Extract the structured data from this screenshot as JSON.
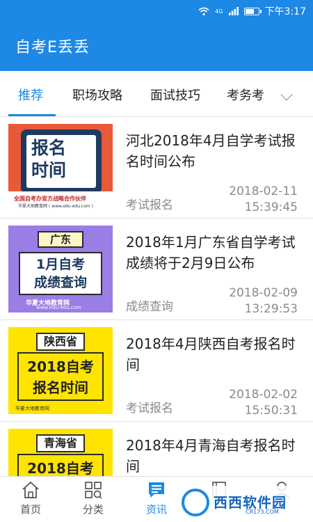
{
  "status_bar": {
    "time": "下午3:17",
    "signal": "4G"
  },
  "app": {
    "title": "自考E丢丢"
  },
  "tabs": [
    {
      "label": "推荐",
      "active": true
    },
    {
      "label": "职场攻略",
      "active": false
    },
    {
      "label": "面试技巧",
      "active": false
    },
    {
      "label": "考务考",
      "active": false
    }
  ],
  "articles": [
    {
      "title": "河北2018年4月自学考试报名时间公布",
      "category": "考试报名",
      "date": "2018-02-11",
      "time": "15:39:45",
      "thumb": {
        "line1": "报名",
        "line2": "时间",
        "caption": "全国自考办官方战略合作伙伴",
        "brand": "华夏大地教育网 ( www.edu-edu.com )"
      }
    },
    {
      "title": "2018年1月广东省自学考试成绩将于2月9日公布",
      "category": "成绩查询",
      "date": "2018-02-09",
      "time": "13:29:53",
      "thumb": {
        "ribbon": "广东",
        "line1": "1月自考",
        "line2": "成绩查询",
        "brand": "华夏大地教育网",
        "url": "www.edu-edu.com"
      }
    },
    {
      "title": "2018年4月陕西自考报名时间",
      "category": "考试报名",
      "date": "2018-02-02",
      "time": "15:50:31",
      "thumb": {
        "ribbon": "陕西省",
        "line1": "2018自考",
        "line2": "报名时间",
        "brand": "华夏大地教育网"
      }
    },
    {
      "title": "2018年4月青海自考报名时间",
      "category": "",
      "date": "",
      "time": "",
      "thumb": {
        "ribbon": "青海省",
        "line1": "2018自考",
        "line2": "",
        "brand": ""
      }
    }
  ],
  "bottom_nav": [
    {
      "label": "首页",
      "icon": "home-icon",
      "active": false
    },
    {
      "label": "分类",
      "icon": "category-icon",
      "active": false
    },
    {
      "label": "资讯",
      "icon": "news-icon",
      "active": true
    },
    {
      "label": "",
      "icon": "book-icon",
      "active": false
    },
    {
      "label": "",
      "icon": "profile-icon",
      "active": false
    }
  ],
  "watermark": {
    "text": "西西软件园",
    "url": "CR173.COM"
  },
  "colors": {
    "primary": "#1e88e5",
    "text": "#222222",
    "muted": "#8a8a8a"
  },
  "battery_level": 0.6
}
